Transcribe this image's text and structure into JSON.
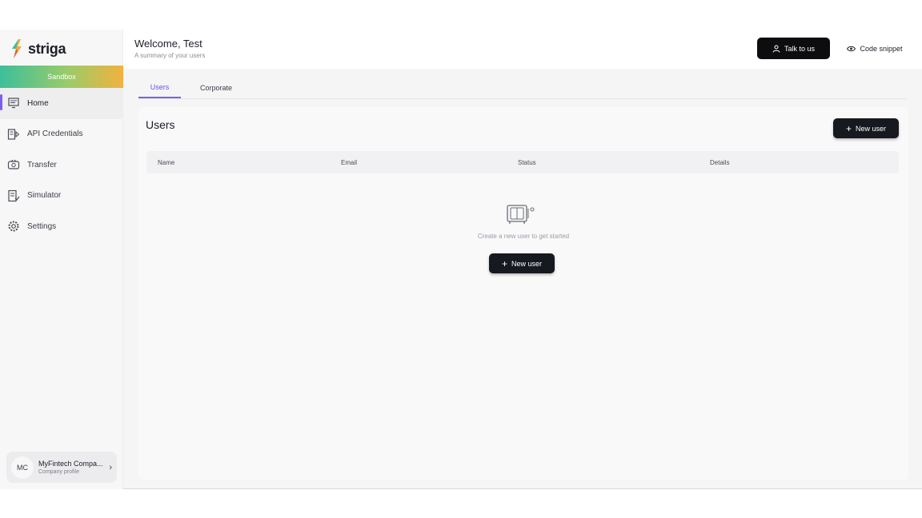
{
  "brand": {
    "name": "striga"
  },
  "environment": {
    "label": "Sandbox"
  },
  "nav": {
    "items": [
      {
        "label": "Home",
        "icon": "home-icon",
        "active": true
      },
      {
        "label": "API Credentials",
        "icon": "api-credentials-icon",
        "active": false
      },
      {
        "label": "Transfer",
        "icon": "transfer-icon",
        "active": false
      },
      {
        "label": "Simulator",
        "icon": "simulator-icon",
        "active": false
      },
      {
        "label": "Settings",
        "icon": "gear-icon",
        "active": false
      }
    ]
  },
  "profile": {
    "initials": "MC",
    "name": "MyFintech Compa...",
    "subtitle": "Company profile"
  },
  "header": {
    "title": "Welcome, Test",
    "subtitle": "A summary of your users",
    "talk_label": "Talk to us",
    "code_label": "Code snippet"
  },
  "tabs": [
    {
      "label": "Users",
      "active": true
    },
    {
      "label": "Corporate",
      "active": false
    }
  ],
  "users": {
    "title": "Users",
    "new_user_label": "New user",
    "columns": [
      "Name",
      "Email",
      "Status",
      "Details"
    ],
    "empty_text": "Create a new user to get started",
    "empty_button_label": "New user"
  },
  "colors": {
    "accent": "#7b5cf5",
    "button_dark": "#16191f",
    "gradient_start": "#3dbf9a",
    "gradient_end": "#f2b23e"
  }
}
